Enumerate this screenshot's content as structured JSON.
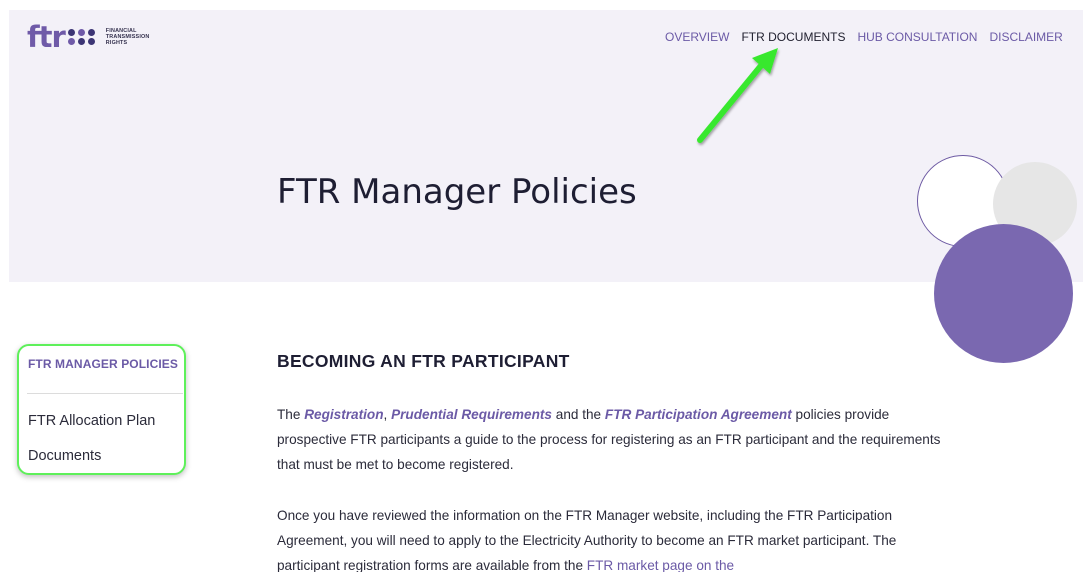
{
  "logo": {
    "word": "ftr",
    "text_lines": [
      "FINANCIAL",
      "TRANSMISSION",
      "RIGHTS"
    ]
  },
  "nav": {
    "items": [
      {
        "label": "OVERVIEW",
        "active": false
      },
      {
        "label": "FTR DOCUMENTS",
        "active": true
      },
      {
        "label": "HUB CONSULTATION",
        "active": false
      },
      {
        "label": "DISCLAIMER",
        "active": false
      }
    ]
  },
  "hero": {
    "title": "FTR Manager Policies"
  },
  "sidebar": {
    "heading": "FTR MANAGER POLICIES",
    "items": [
      {
        "label": "FTR Allocation Plan"
      },
      {
        "label": "Documents"
      }
    ]
  },
  "main": {
    "section_heading": "BECOMING AN FTR PARTICIPANT",
    "p1": {
      "t1": "The ",
      "link_registration": "Registration",
      "t2": ", ",
      "link_prudential": "Prudential Requirements",
      "t3": " and the ",
      "link_agreement": "FTR Participation Agreement",
      "t4": " policies provide prospective FTR participants a guide to the process for registering as an FTR participant and the requirements that must be met to become registered."
    },
    "p2": {
      "text": "Once you have reviewed the information on the FTR Manager website, including the FTR Participation Agreement, you will need to apply to the Electricity Authority to become an FTR market participant. The participant registration forms are available from the ",
      "link": "FTR market page on the"
    }
  },
  "colors": {
    "brand_purple": "#6b5aa6",
    "hero_bg": "#f3f1f8",
    "circle_purple": "#7a68b0",
    "annotation_green": "#5ef05a"
  }
}
